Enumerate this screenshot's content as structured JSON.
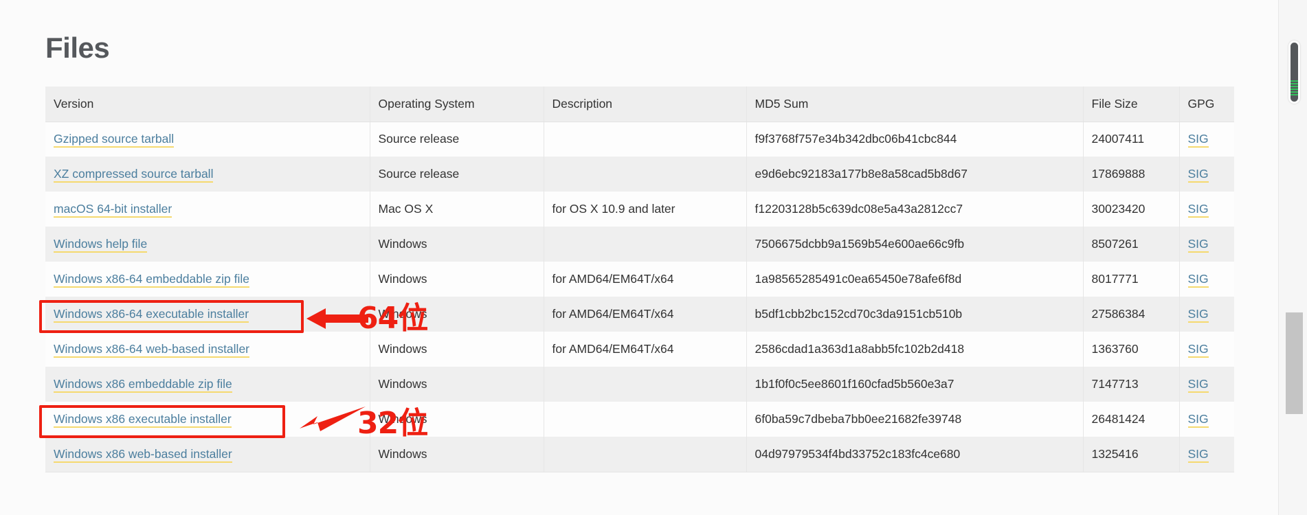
{
  "page": {
    "title": "Files"
  },
  "table": {
    "headers": [
      "Version",
      "Operating System",
      "Description",
      "MD5 Sum",
      "File Size",
      "GPG"
    ],
    "rows": [
      {
        "version": "Gzipped source tarball",
        "os": "Source release",
        "description": "",
        "md5": "f9f3768f757e34b342dbc06b41cbc844",
        "size": "24007411",
        "gpg": "SIG"
      },
      {
        "version": "XZ compressed source tarball",
        "os": "Source release",
        "description": "",
        "md5": "e9d6ebc92183a177b8e8a58cad5b8d67",
        "size": "17869888",
        "gpg": "SIG"
      },
      {
        "version": "macOS 64-bit installer",
        "os": "Mac OS X",
        "description": "for OS X 10.9 and later",
        "md5": "f12203128b5c639dc08e5a43a2812cc7",
        "size": "30023420",
        "gpg": "SIG"
      },
      {
        "version": "Windows help file",
        "os": "Windows",
        "description": "",
        "md5": "7506675dcbb9a1569b54e600ae66c9fb",
        "size": "8507261",
        "gpg": "SIG"
      },
      {
        "version": "Windows x86-64 embeddable zip file",
        "os": "Windows",
        "description": "for AMD64/EM64T/x64",
        "md5": "1a98565285491c0ea65450e78afe6f8d",
        "size": "8017771",
        "gpg": "SIG"
      },
      {
        "version": "Windows x86-64 executable installer",
        "os": "Windows",
        "description": "for AMD64/EM64T/x64",
        "md5": "b5df1cbb2bc152cd70c3da9151cb510b",
        "size": "27586384",
        "gpg": "SIG"
      },
      {
        "version": "Windows x86-64 web-based installer",
        "os": "Windows",
        "description": "for AMD64/EM64T/x64",
        "md5": "2586cdad1a363d1a8abb5fc102b2d418",
        "size": "1363760",
        "gpg": "SIG"
      },
      {
        "version": "Windows x86 embeddable zip file",
        "os": "Windows",
        "description": "",
        "md5": "1b1f0f0c5ee8601f160cfad5b560e3a7",
        "size": "7147713",
        "gpg": "SIG"
      },
      {
        "version": "Windows x86 executable installer",
        "os": "Windows",
        "description": "",
        "md5": "6f0ba59c7dbeba7bb0ee21682fe39748",
        "size": "26481424",
        "gpg": "SIG"
      },
      {
        "version": "Windows x86 web-based installer",
        "os": "Windows",
        "description": "",
        "md5": "04d97979534f4bd33752c183fc4ce680",
        "size": "1325416",
        "gpg": "SIG"
      }
    ]
  },
  "annotations": {
    "color": "#ee2012",
    "items": [
      {
        "label": "64位",
        "target_row": "Windows x86-64 executable installer"
      },
      {
        "label": "32位",
        "target_row": "Windows x86 executable installer"
      }
    ]
  },
  "theme": {
    "link_color": "#4b7e9e",
    "link_underline_color": "#f5d96f",
    "header_bg": "#eeeeee",
    "row_alt_bg": "#efefef",
    "page_bg": "#fbfbfb",
    "title_color": "#55585c",
    "scroll_mark_color": "#35c05c"
  }
}
